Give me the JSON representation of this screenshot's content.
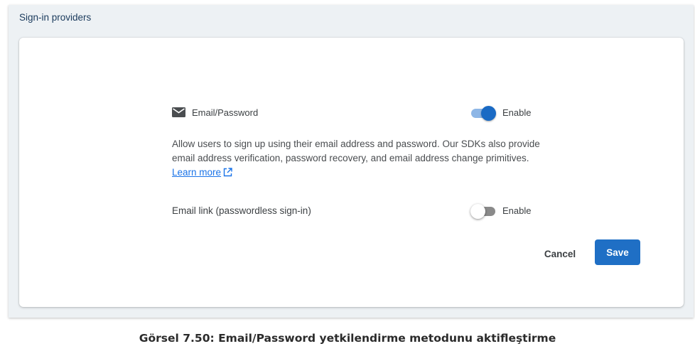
{
  "section": {
    "title": "Sign-in providers"
  },
  "email_password": {
    "icon": "mail-icon",
    "label": "Email/Password",
    "enabled": true,
    "toggle_label": "Enable"
  },
  "description": {
    "text": "Allow users to sign up using their email address and password. Our SDKs also provide email address verification, password recovery, and email address change primitives.",
    "link_text": "Learn more",
    "link_icon": "external-link-icon"
  },
  "email_link": {
    "label": "Email link (passwordless sign-in)",
    "enabled": false,
    "toggle_label": "Enable"
  },
  "actions": {
    "cancel_label": "Cancel",
    "save_label": "Save"
  },
  "caption": "Görsel 7.50: Email/Password yetkilendirme metodunu aktifleştirme",
  "colors": {
    "accent": "#1a6ac4",
    "toggle_track_on": "#8db6e6",
    "save_button": "#1f6fc5",
    "link": "#1a73e8"
  }
}
